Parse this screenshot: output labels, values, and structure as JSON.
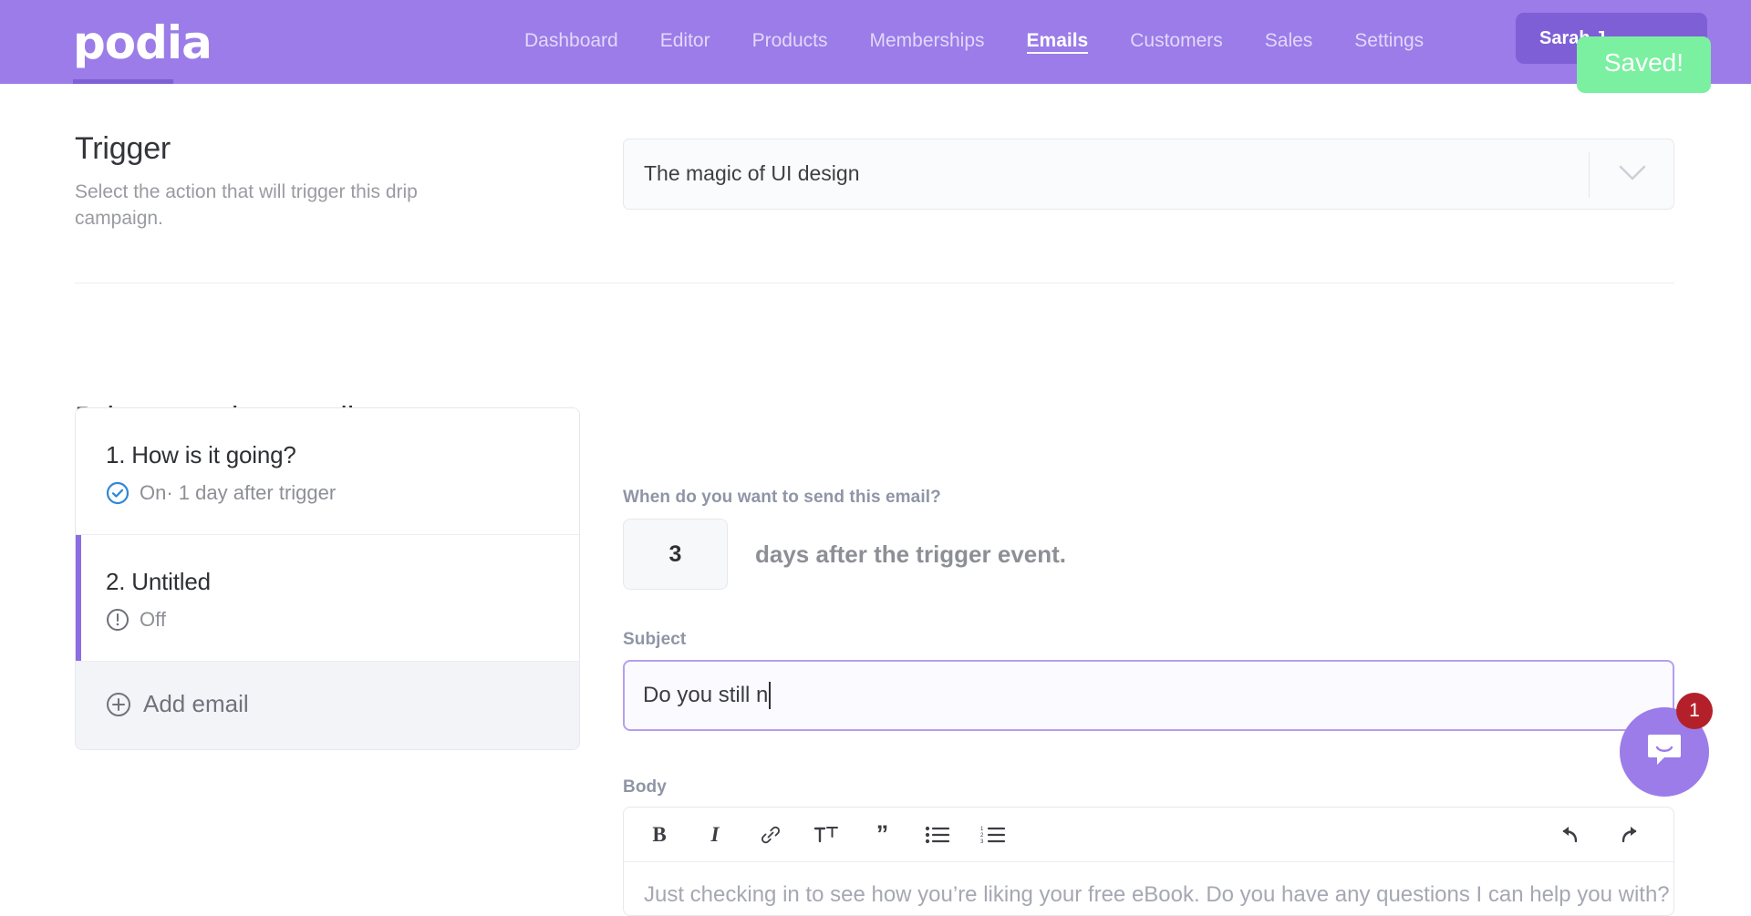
{
  "header": {
    "logo": "podia",
    "nav": [
      {
        "label": "Dashboard",
        "active": false
      },
      {
        "label": "Editor",
        "active": false
      },
      {
        "label": "Products",
        "active": false
      },
      {
        "label": "Memberships",
        "active": false
      },
      {
        "label": "Emails",
        "active": true
      },
      {
        "label": "Customers",
        "active": false
      },
      {
        "label": "Sales",
        "active": false
      },
      {
        "label": "Settings",
        "active": false
      }
    ],
    "user": "Sarah J",
    "brand_color": "#9b7ce8",
    "accent_color": "#7f5fd6"
  },
  "toast": {
    "message": "Saved!",
    "color": "#7af0a0"
  },
  "trigger": {
    "title": "Trigger",
    "description": "Select the action that will trigger this drip campaign.",
    "selected": "The magic of UI design",
    "chevron": "chevron-down-icon"
  },
  "drip": {
    "title": "Drip campaign emails",
    "emails": [
      {
        "name": "1. How is it going?",
        "status": "On· 1 day after trigger",
        "status_icon": "check-circle-icon",
        "selected": false
      },
      {
        "name": "2. Untitled",
        "status": "Off",
        "status_icon": "exclamation-circle-icon",
        "selected": true
      }
    ],
    "add_label": "Add email",
    "add_icon": "plus-circle-icon",
    "selected_bar_color": "#8c6ee0"
  },
  "editor": {
    "when_label": "When do you want to send this email?",
    "days_value": "3",
    "days_suffix": "days after the trigger event.",
    "subject_label": "Subject",
    "subject_value": "Do you still n",
    "body_label": "Body",
    "body_placeholder": "Just checking in to see how you’re liking your free eBook. Do you have any questions I can help you with?",
    "toolbar": [
      {
        "name": "bold-button",
        "title": "Bold"
      },
      {
        "name": "italic-button",
        "title": "Italic"
      },
      {
        "name": "link-button",
        "title": "Link"
      },
      {
        "name": "text-size-button",
        "title": "Text size"
      },
      {
        "name": "blockquote-button",
        "title": "Quote"
      },
      {
        "name": "bullet-list-button",
        "title": "Bulleted list"
      },
      {
        "name": "numbered-list-button",
        "title": "Numbered list"
      }
    ],
    "undo_label": "Undo",
    "redo_label": "Redo"
  },
  "chat": {
    "icon": "chat-bubble-icon",
    "unread": "1"
  }
}
